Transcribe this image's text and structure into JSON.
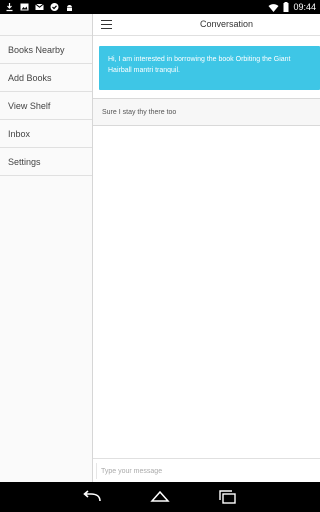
{
  "status_bar": {
    "time": "09:44",
    "left_icons": [
      "download-icon",
      "image-icon",
      "gmail-icon",
      "check-icon",
      "android-icon"
    ],
    "right_icons": [
      "wifi-icon",
      "battery-icon"
    ]
  },
  "sidebar": {
    "items": [
      {
        "label": "Books Nearby"
      },
      {
        "label": "Add Books"
      },
      {
        "label": "View Shelf"
      },
      {
        "label": "Inbox"
      },
      {
        "label": "Settings"
      }
    ]
  },
  "header": {
    "title": "Conversation",
    "menu_icon": "menu-icon"
  },
  "messages": [
    {
      "direction": "incoming",
      "text": "Hi, I am interested in borrowing the book Orbiting the Giant Hairball mantri tranquil.",
      "color": "#3ec6e6"
    },
    {
      "direction": "outgoing",
      "text": "Sure I stay thy there too"
    }
  ],
  "composer": {
    "placeholder": "Type your message"
  },
  "nav_bar": {
    "icons": [
      "back-icon",
      "home-icon",
      "recents-icon"
    ]
  }
}
